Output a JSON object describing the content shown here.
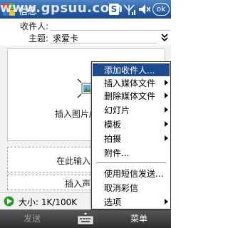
{
  "watermark": "www.gpsuu.com",
  "titlebar": {
    "title": "信息",
    "start_icon": "windows-flag-icon",
    "indicators": {
      "s_label": "S",
      "signal_icon": "signal-icon",
      "volume_icon": "speaker-muted-icon",
      "ok_label": "ok"
    }
  },
  "header": {
    "to_label": "收件人:",
    "subject_label": "主题:",
    "subject_value": "求爱卡"
  },
  "body": {
    "insert_picture_label": "插入图片/",
    "insert_text_label": "在此输入",
    "insert_sound_label": "插入声"
  },
  "size_bar": {
    "size_text": "大小: 1K/100K"
  },
  "softkeys": {
    "left": "发送",
    "right": "菜单"
  },
  "menu": {
    "items": [
      {
        "label": "添加收件人...",
        "submenu": false,
        "selected": true
      },
      {
        "label": "插入媒体文件",
        "submenu": true,
        "selected": false
      },
      {
        "label": "删除媒体文件",
        "submenu": true,
        "selected": false
      },
      {
        "label": "幻灯片",
        "submenu": true,
        "selected": false
      },
      {
        "label": "模板",
        "submenu": true,
        "selected": false
      },
      {
        "label": "拍摄",
        "submenu": true,
        "selected": false
      },
      {
        "label": "附件...",
        "submenu": false,
        "selected": false
      },
      {
        "label": "使用短信发送...",
        "submenu": false,
        "selected": false
      },
      {
        "label": "取消彩信",
        "submenu": false,
        "selected": false
      },
      {
        "label": "选项",
        "submenu": true,
        "selected": false
      }
    ]
  },
  "colors": {
    "titlebar": "#2b5fa8",
    "menu_selected": "#1c4a8c",
    "softkey_bar": "#3a3a3a"
  }
}
